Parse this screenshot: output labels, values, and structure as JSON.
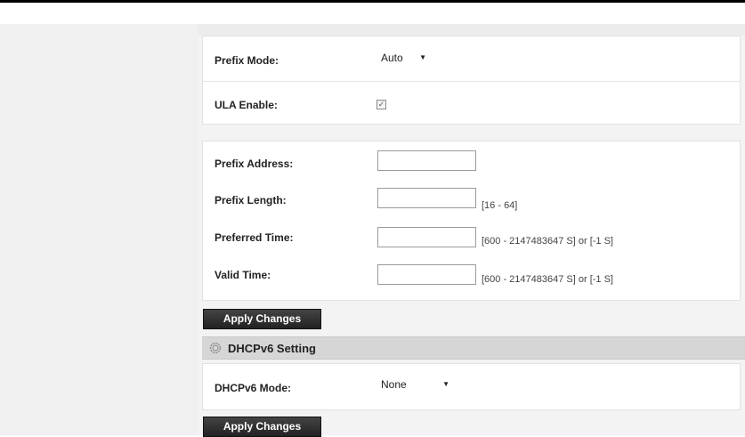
{
  "prefix_section": {
    "prefix_mode_label": "Prefix Mode:",
    "prefix_mode_value": "Auto",
    "ula_enable_label": "ULA Enable:",
    "ula_enable_checked": true
  },
  "prefix_fields": {
    "prefix_address_label": "Prefix Address:",
    "prefix_address_value": "",
    "prefix_length_label": "Prefix Length:",
    "prefix_length_value": "",
    "prefix_length_hint": "[16 - 64]",
    "preferred_time_label": "Preferred Time:",
    "preferred_time_value": "",
    "preferred_time_hint": "[600 - 2147483647 S] or [-1 S]",
    "valid_time_label": "Valid Time:",
    "valid_time_value": "",
    "valid_time_hint": "[600 - 2147483647 S] or [-1 S]"
  },
  "buttons": {
    "apply_label_1": "Apply Changes",
    "apply_label_2": "Apply Changes"
  },
  "dhcpv6_section": {
    "title": "DHCPv6 Setting",
    "icon": "gear-icon",
    "mode_label": "DHCPv6 Mode:",
    "mode_value": "None"
  }
}
